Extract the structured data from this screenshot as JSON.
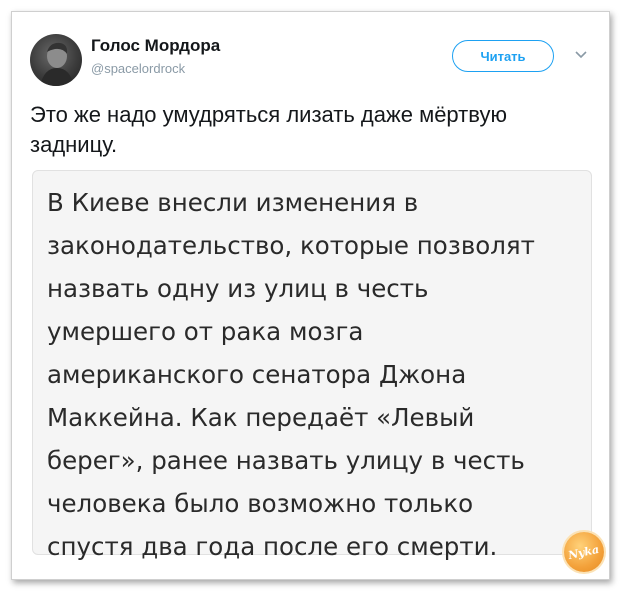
{
  "tweet": {
    "display_name": "Голос Мордора",
    "handle": "@spacelordrock",
    "follow_label": "Читать",
    "text": "Это же надо умудряться лизать даже мёртвую задницу.",
    "quote_text": "В Киеве внесли изменения в\nзаконодательство, которые позволят\nназвать одну из улиц в честь\nумершего от рака мозга\nамериканского сенатора Джона\nМаккейна. Как передаёт «Левый\nберег», ранее назвать улицу в честь\nчеловека было возможно только\nспустя два года после его смерти."
  },
  "watermark": {
    "text": "Nyka"
  },
  "icons": {
    "menu": "chevron-down-icon",
    "avatar": "avatar"
  },
  "colors": {
    "accent": "#1da1f2",
    "text": "#14171a",
    "muted": "#8a9aa6",
    "quote_bg": "#f5f5f5"
  }
}
